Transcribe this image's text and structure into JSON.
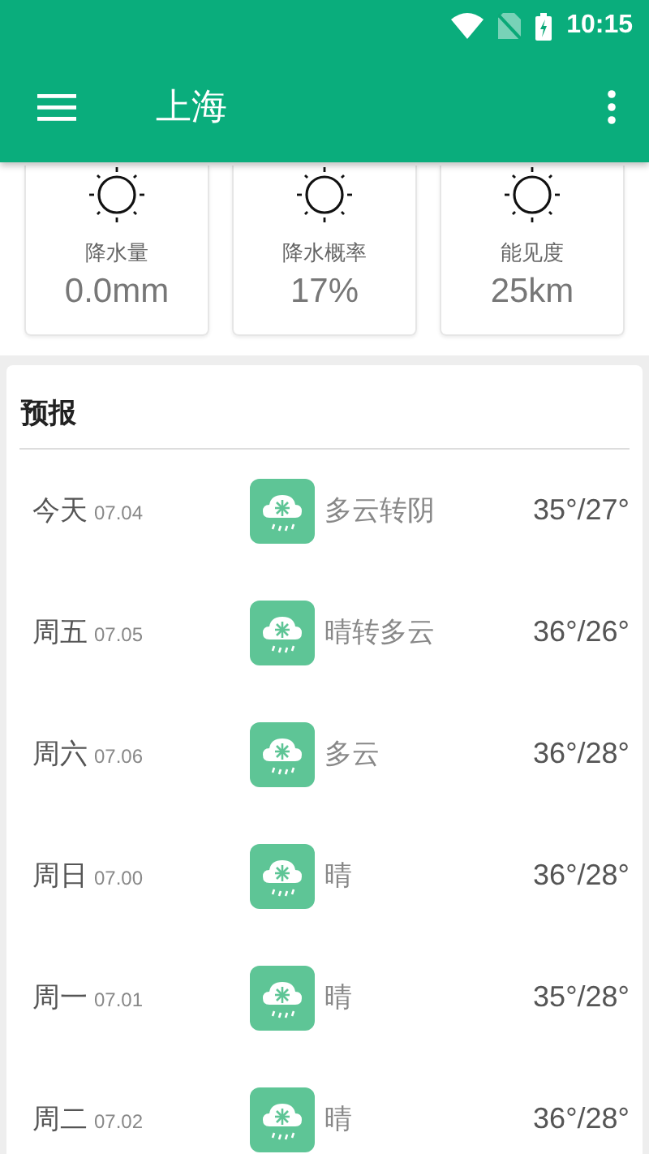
{
  "status_bar": {
    "time": "10:15"
  },
  "app_bar": {
    "title": "上海"
  },
  "stats": [
    {
      "label": "降水量",
      "value": "0.0mm"
    },
    {
      "label": "降水概率",
      "value": "17%"
    },
    {
      "label": "能见度",
      "value": "25km"
    }
  ],
  "forecast": {
    "title": "预报",
    "days": [
      {
        "day": "今天",
        "date": "07.04",
        "condition": "多云转阴",
        "temp": "35°/27°"
      },
      {
        "day": "周五",
        "date": "07.05",
        "condition": "晴转多云",
        "temp": "36°/26°"
      },
      {
        "day": "周六",
        "date": "07.06",
        "condition": "多云",
        "temp": "36°/28°"
      },
      {
        "day": "周日",
        "date": "07.00",
        "condition": "晴",
        "temp": "36°/28°"
      },
      {
        "day": "周一",
        "date": "07.01",
        "condition": "晴",
        "temp": "35°/28°"
      },
      {
        "day": "周二",
        "date": "07.02",
        "condition": "晴",
        "temp": "36°/28°"
      }
    ]
  }
}
